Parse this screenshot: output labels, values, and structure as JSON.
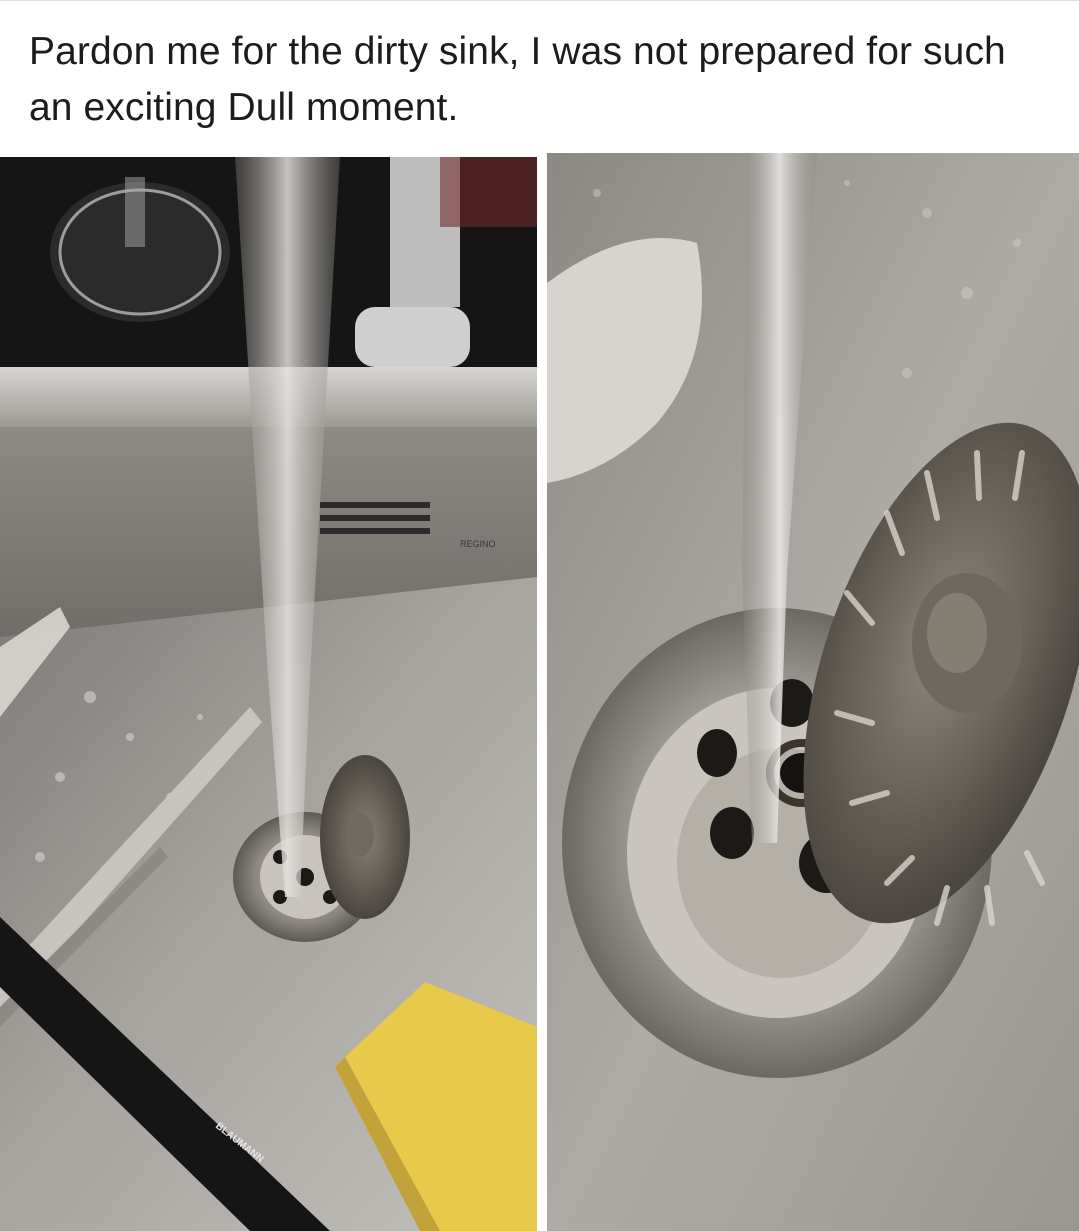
{
  "post": {
    "caption": "Pardon me for the dirty sink, I was not prepared for such an exciting Dull moment."
  },
  "photos": {
    "left": {
      "knife_brand": "BLAUMANN",
      "sink_brand": "REGINO"
    },
    "right": {}
  },
  "colors": {
    "background": "#ffffff",
    "caption_text": "#1c1c1c",
    "steel": "#9a9a98",
    "sponge": "#e8c94a"
  }
}
